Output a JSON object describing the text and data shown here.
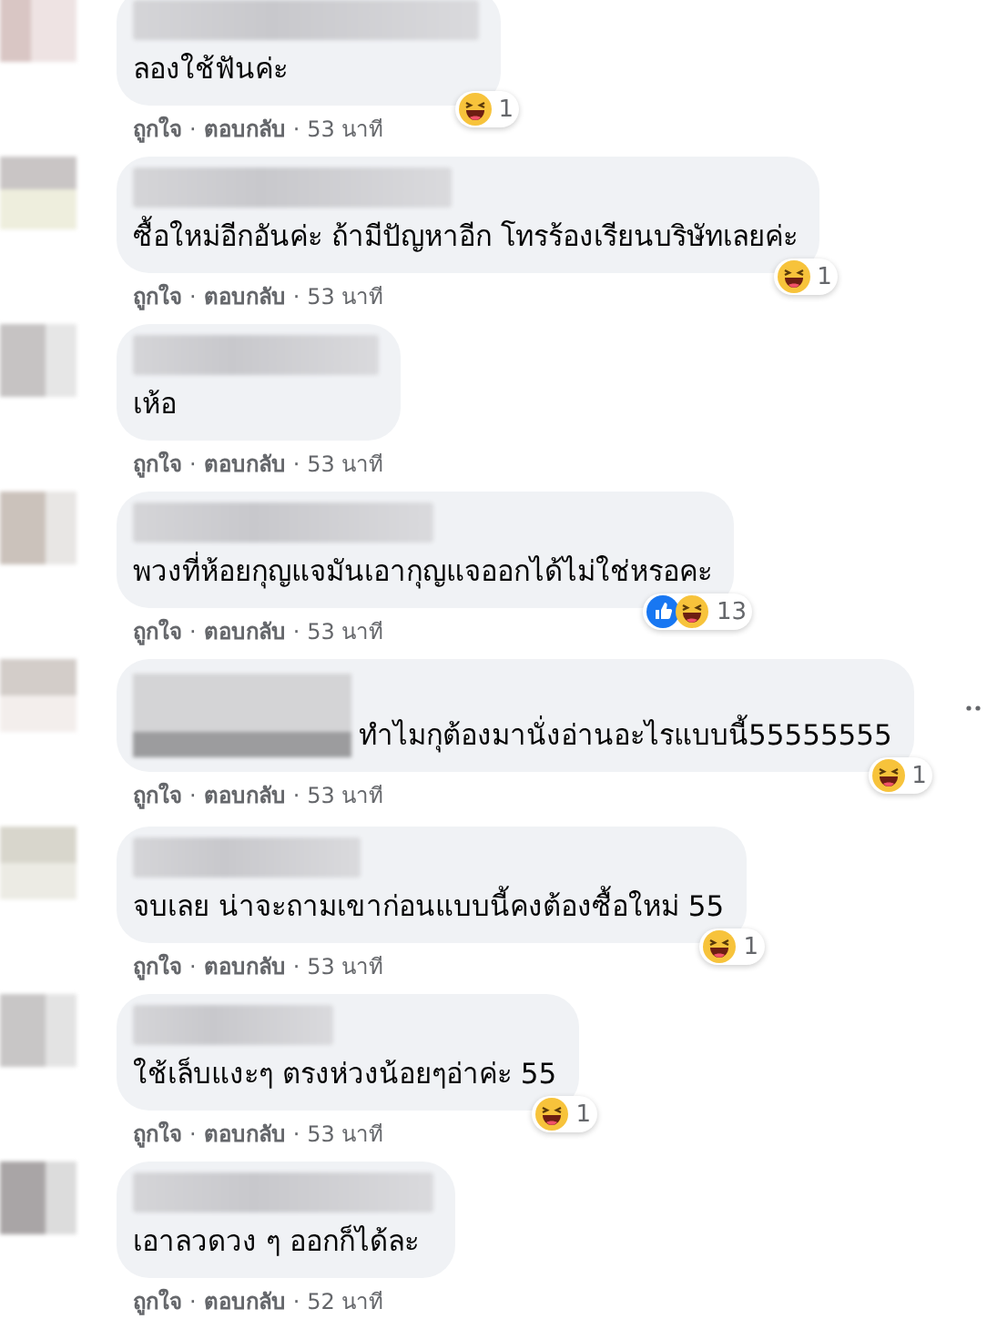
{
  "separator": "·",
  "comments": [
    {
      "kind": "plain",
      "text": "ลองใช้ฟันค่ะ",
      "menu_visible": false,
      "reactions": [
        {
          "kind": "haha"
        }
      ],
      "reaction_count": "1",
      "like": "ถูกใจ",
      "reply": "ตอบกลับ",
      "time": "53 นาที"
    },
    {
      "kind": "plain",
      "text": "ซื้อใหม่อีกอันค่ะ ถ้ามีปัญหาอีก โทรร้องเรียนบริษัทเลยค่ะ",
      "menu_visible": false,
      "reactions": [
        {
          "kind": "haha"
        }
      ],
      "reaction_count": "1",
      "like": "ถูกใจ",
      "reply": "ตอบกลับ",
      "time": "53 นาที"
    },
    {
      "kind": "plain",
      "text": "เห้อ",
      "menu_visible": false,
      "like": "ถูกใจ",
      "reply": "ตอบกลับ",
      "time": "53 นาที"
    },
    {
      "kind": "plain",
      "text": "พวงที่ห้อยกุญแจมันเอากุญแจออกได้ไม่ใช่หรอคะ",
      "menu_visible": false,
      "reactions": [
        {
          "kind": "like"
        },
        {
          "kind": "haha"
        }
      ],
      "reaction_count": "13",
      "like": "ถูกใจ",
      "reply": "ตอบกลับ",
      "time": "53 นาที"
    },
    {
      "kind": "mention",
      "text": "ทำไมกุต้องมานั่งอ่านอะไรแบบนี้55555555",
      "menu_visible": true,
      "reactions": [
        {
          "kind": "haha"
        }
      ],
      "reaction_count": "1",
      "like": "ถูกใจ",
      "reply": "ตอบกลับ",
      "time": "53 นาที"
    },
    {
      "kind": "plain",
      "text": "จบเลย น่าจะถามเขาก่อนแบบนี้คงต้องซื้อใหม่ 55",
      "menu_visible": false,
      "reactions": [
        {
          "kind": "haha"
        }
      ],
      "reaction_count": "1",
      "like": "ถูกใจ",
      "reply": "ตอบกลับ",
      "time": "53 นาที"
    },
    {
      "kind": "plain",
      "text": "ใช้เล็บแงะๆ ตรงห่วงน้อยๆอ่าค่ะ 55",
      "menu_visible": false,
      "reactions": [
        {
          "kind": "haha"
        }
      ],
      "reaction_count": "1",
      "like": "ถูกใจ",
      "reply": "ตอบกลับ",
      "time": "53 นาที"
    },
    {
      "kind": "plain",
      "text": "เอาลวดวง ๆ ออกก็ได้ละ",
      "menu_visible": false,
      "like": "ถูกใจ",
      "reply": "ตอบกลับ",
      "time": "52 นาที"
    }
  ]
}
